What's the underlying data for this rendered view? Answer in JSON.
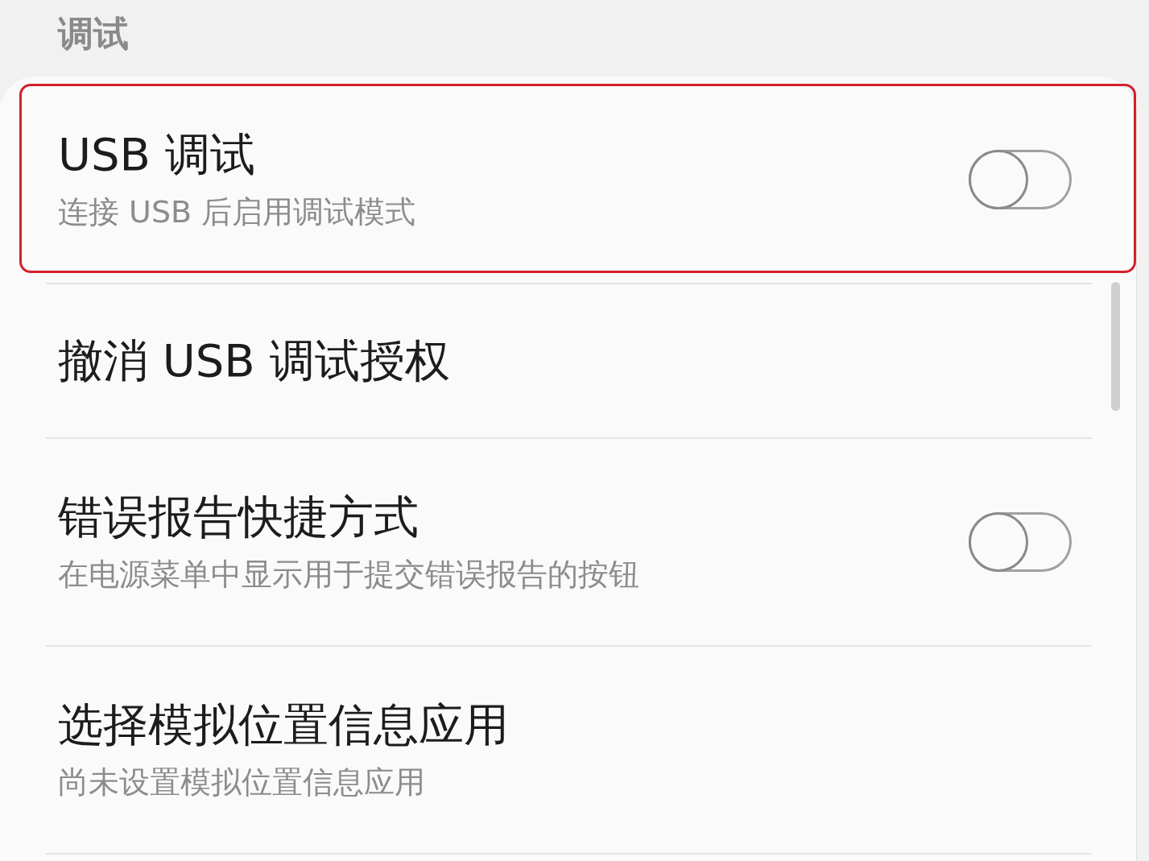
{
  "section_title": "调试",
  "items": [
    {
      "kind": "switch",
      "title": "USB 调试",
      "subtitle": "连接 USB 后启用调试模式",
      "on": false,
      "highlighted": true
    },
    {
      "kind": "plain",
      "title": "撤消 USB 调试授权",
      "highlighted": false
    },
    {
      "kind": "switch",
      "title": "错误报告快捷方式",
      "subtitle": "在电源菜单中显示用于提交错误报告的按钮",
      "on": false,
      "highlighted": false
    },
    {
      "kind": "plain",
      "title": "选择模拟位置信息应用",
      "subtitle": "尚未设置模拟位置信息应用",
      "highlighted": false
    }
  ]
}
